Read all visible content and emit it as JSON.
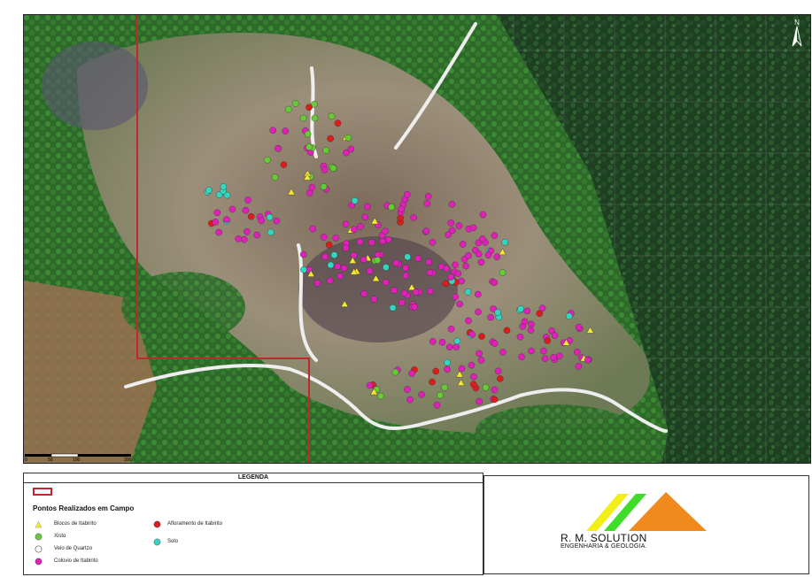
{
  "legend": {
    "header": "LEGENDA",
    "section_title": "Pontos Realizados em Campo",
    "items": [
      {
        "key": "blocos",
        "label": "Blocos de Itabirito",
        "symbol": "triangle",
        "color": "#f4e830"
      },
      {
        "key": "xisto",
        "label": "Xisto",
        "symbol": "circle",
        "color": "#66cc33"
      },
      {
        "key": "veio",
        "label": "Veio de Quartzo",
        "symbol": "circle-open",
        "color": "#ffffff"
      },
      {
        "key": "coluvio",
        "label": "Colúvio de Itabirito",
        "symbol": "circle",
        "color": "#e020b8"
      },
      {
        "key": "afloramento",
        "label": "Afloramento de Itabirito",
        "symbol": "circle",
        "color": "#dd1c1c"
      },
      {
        "key": "solo",
        "label": "Solo",
        "symbol": "circle",
        "color": "#33d6c0"
      }
    ]
  },
  "scalebar": {
    "labels": [
      "0",
      "50",
      "100",
      "200"
    ]
  },
  "north": {
    "label": "N"
  },
  "logo": {
    "name": "R. M. SOLUTION",
    "subtitle": "ENGENHARIA & GEOLOGIA.",
    "colors": {
      "yellow": "#f2ee1a",
      "green": "#3fdc2a",
      "orange": "#f08a1c"
    }
  },
  "colors": {
    "area_outline": "#c0282d",
    "road": "#eeeeee"
  }
}
